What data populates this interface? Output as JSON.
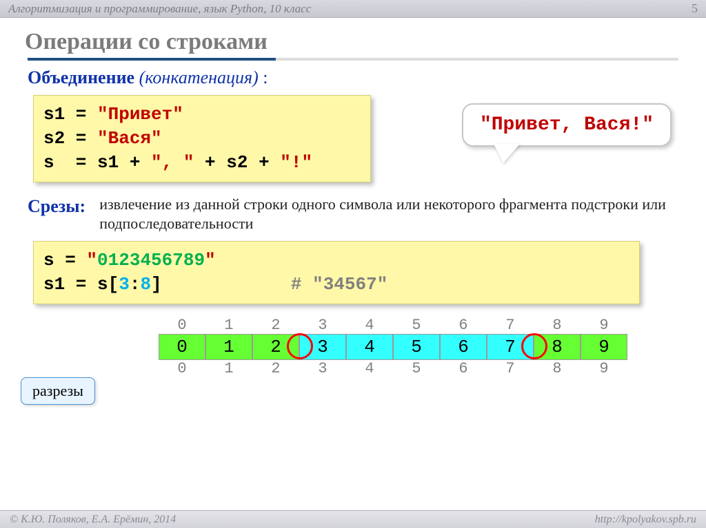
{
  "topbar": {
    "course": "Алгоритмизация и программирование, язык Python, 10 класс"
  },
  "pagenum": "5",
  "title": "Операции со строками",
  "section_concat": {
    "label": "Объединение",
    "paren": "(конкатенация)",
    "colon": " :"
  },
  "code1": {
    "l1_lhs": "s1 = ",
    "l1_str": "\"Привет\"",
    "l2_lhs": "s2 = ",
    "l2_str": "\"Вася\"",
    "l3_a": "s  = s1 + ",
    "l3_b": "\", \"",
    "l3_c": " + s2 + ",
    "l3_d": "\"!\""
  },
  "bubble": "\"Привет, Вася!\"",
  "section_slice": {
    "label": "Срезы:"
  },
  "slice_desc": "извлечение из данной строки одного символа или некоторого фрагмента подстроки или подпоследовательности",
  "code2": {
    "l1_lhs": "s = ",
    "l1_q1": "\"",
    "l1_num": "0123456789",
    "l1_q2": "\"",
    "l2_a": "s1 = s[",
    "l2_i1": "3",
    "l2_col": ":",
    "l2_i2": "8",
    "l2_b": "]",
    "l2_pad": "            ",
    "l2_c": "# \"34567\""
  },
  "indices_top": [
    "0",
    "1",
    "2",
    "3",
    "4",
    "5",
    "6",
    "7",
    "8",
    "9"
  ],
  "cells": [
    "0",
    "1",
    "2",
    "3",
    "4",
    "5",
    "6",
    "7",
    "8",
    "9"
  ],
  "indices_bot": [
    "0",
    "1",
    "2",
    "3",
    "4",
    "5",
    "6",
    "7",
    "8",
    "9"
  ],
  "tag_text": "разрезы",
  "footer": {
    "left": "© К.Ю. Поляков, Е.А. Ерёмин, 2014",
    "right": "http://kpolyakov.spb.ru"
  }
}
